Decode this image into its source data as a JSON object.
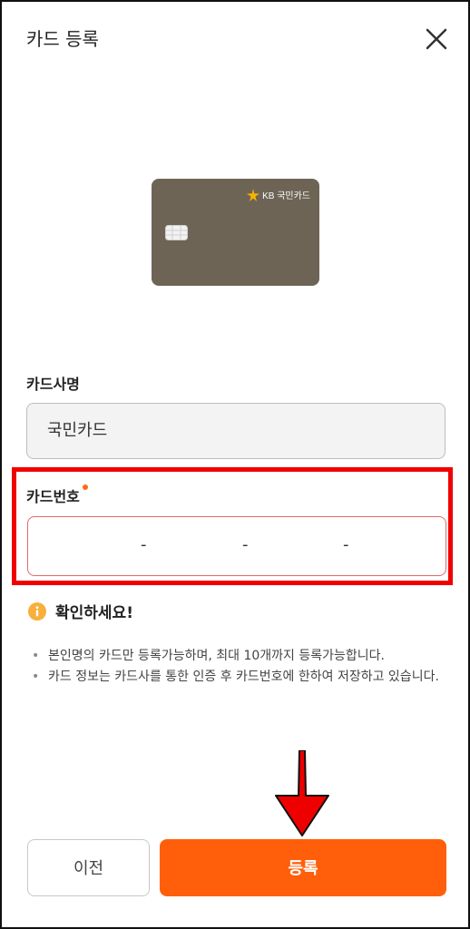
{
  "header": {
    "title": "카드 등록",
    "close_icon": "close-icon"
  },
  "card_preview": {
    "brand_logo_text": "KB 국민카드",
    "card_color": "#6e6456",
    "logo_icon": "kb-star-icon",
    "chip_icon": "chip-icon"
  },
  "form": {
    "company_label": "카드사명",
    "company_value": "국민카드",
    "number_label": "카드번호",
    "number_separator": "-",
    "required_dot_color": "#ff6a13"
  },
  "notice": {
    "title": "확인하세요!",
    "icon": "info-icon",
    "items": [
      "본인명의 카드만 등록가능하며, 최대 10개까지 등록가능합니다.",
      "카드 정보는 카드사를 통한 인증 후 카드번호에 한하여 저장하고 있습니다."
    ]
  },
  "buttons": {
    "prev_label": "이전",
    "register_label": "등록",
    "accent_color": "#ff5f0a"
  },
  "annotation": {
    "highlight_color": "#f00000",
    "arrow_icon": "arrow-down-icon"
  }
}
